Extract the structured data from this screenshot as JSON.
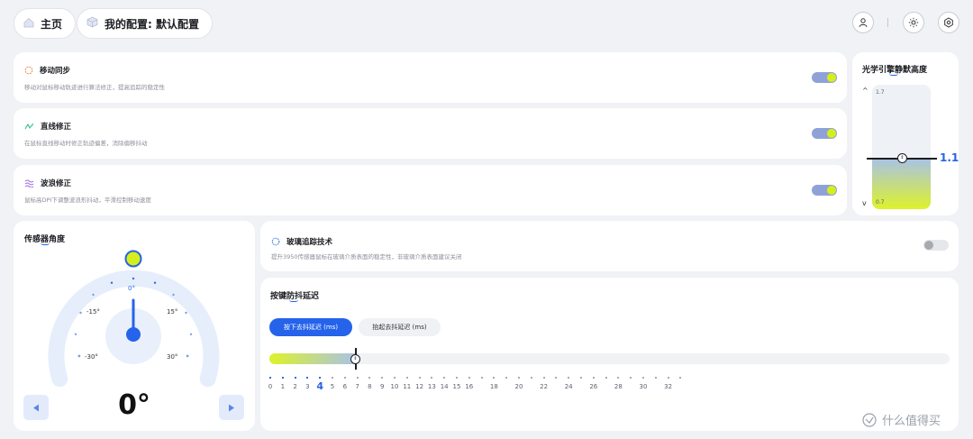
{
  "header": {
    "home_label": "主页",
    "config_label": "我的配置: 默认配置"
  },
  "options": [
    {
      "title": "移动同步",
      "desc": "移动对鼠标移动轨迹进行算法修正，提高追踪的稳定性",
      "on": true
    },
    {
      "title": "直线修正",
      "desc": "在鼠标直线移动时修正轨迹偏差，消除偏移抖动",
      "on": true
    },
    {
      "title": "波浪修正",
      "desc": "鼠标高DPI下调整波浪形抖动，平滑控制移动速度",
      "on": true
    }
  ],
  "lod": {
    "title": "光学引擎静默高度",
    "max": "1.7",
    "min": "0.7",
    "value": "1.1"
  },
  "angle": {
    "title": "传感器角度",
    "labels": [
      "0°",
      "-15°",
      "15°",
      "-30°",
      "30°"
    ],
    "value": "0°"
  },
  "glass": {
    "title": "玻璃追踪技术",
    "desc": "提升3950传感器鼠标在玻璃介质表面的稳定性，非玻璃介质表面建议关闭",
    "on": false
  },
  "debounce": {
    "title": "按键防抖延迟",
    "tab_press": "按下去抖延迟 (ms)",
    "tab_release": "抬起去抖延迟 (ms)",
    "ticks": [
      "0",
      "1",
      "2",
      "3",
      "4",
      "5",
      "6",
      "7",
      "8",
      "9",
      "10",
      "11",
      "12",
      "13",
      "14",
      "15",
      "16",
      "18",
      "20",
      "22",
      "24",
      "26",
      "28",
      "30",
      "32"
    ],
    "selected": "4"
  },
  "watermark": "什么值得买"
}
